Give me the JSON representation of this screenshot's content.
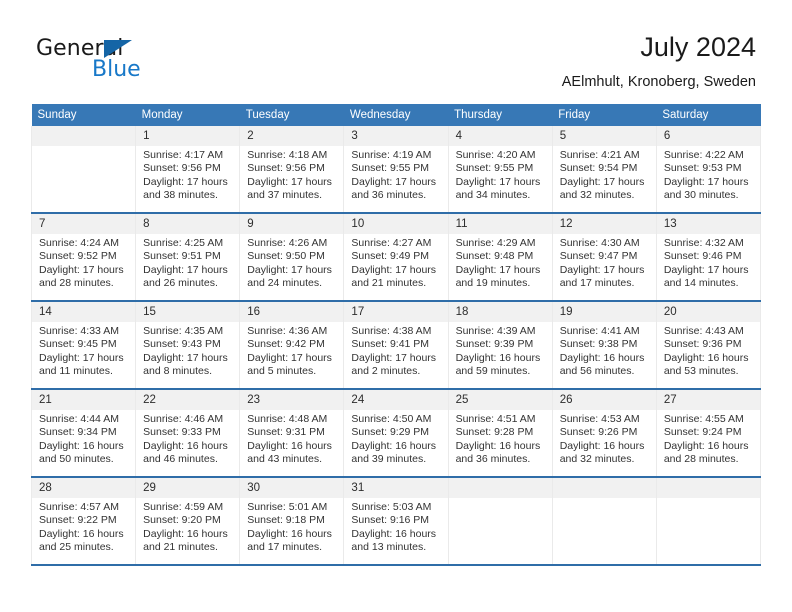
{
  "brand": {
    "name_part1": "General",
    "name_part2": "Blue",
    "logo_icon": "triangle-logo-icon"
  },
  "header": {
    "title": "July 2024",
    "subtitle": "AElmhult, Kronoberg, Sweden"
  },
  "calendar": {
    "weekday_headers": [
      "Sunday",
      "Monday",
      "Tuesday",
      "Wednesday",
      "Thursday",
      "Friday",
      "Saturday"
    ],
    "header_bg_color": "#3778b6",
    "row_separator_color": "#2f6da8",
    "daynum_bg_color": "#f1f1f1",
    "weeks": [
      [
        {
          "day": "",
          "sunrise": "",
          "sunset": "",
          "daylight1": "",
          "daylight2": ""
        },
        {
          "day": "1",
          "sunrise": "Sunrise: 4:17 AM",
          "sunset": "Sunset: 9:56 PM",
          "daylight1": "Daylight: 17 hours",
          "daylight2": "and 38 minutes."
        },
        {
          "day": "2",
          "sunrise": "Sunrise: 4:18 AM",
          "sunset": "Sunset: 9:56 PM",
          "daylight1": "Daylight: 17 hours",
          "daylight2": "and 37 minutes."
        },
        {
          "day": "3",
          "sunrise": "Sunrise: 4:19 AM",
          "sunset": "Sunset: 9:55 PM",
          "daylight1": "Daylight: 17 hours",
          "daylight2": "and 36 minutes."
        },
        {
          "day": "4",
          "sunrise": "Sunrise: 4:20 AM",
          "sunset": "Sunset: 9:55 PM",
          "daylight1": "Daylight: 17 hours",
          "daylight2": "and 34 minutes."
        },
        {
          "day": "5",
          "sunrise": "Sunrise: 4:21 AM",
          "sunset": "Sunset: 9:54 PM",
          "daylight1": "Daylight: 17 hours",
          "daylight2": "and 32 minutes."
        },
        {
          "day": "6",
          "sunrise": "Sunrise: 4:22 AM",
          "sunset": "Sunset: 9:53 PM",
          "daylight1": "Daylight: 17 hours",
          "daylight2": "and 30 minutes."
        }
      ],
      [
        {
          "day": "7",
          "sunrise": "Sunrise: 4:24 AM",
          "sunset": "Sunset: 9:52 PM",
          "daylight1": "Daylight: 17 hours",
          "daylight2": "and 28 minutes."
        },
        {
          "day": "8",
          "sunrise": "Sunrise: 4:25 AM",
          "sunset": "Sunset: 9:51 PM",
          "daylight1": "Daylight: 17 hours",
          "daylight2": "and 26 minutes."
        },
        {
          "day": "9",
          "sunrise": "Sunrise: 4:26 AM",
          "sunset": "Sunset: 9:50 PM",
          "daylight1": "Daylight: 17 hours",
          "daylight2": "and 24 minutes."
        },
        {
          "day": "10",
          "sunrise": "Sunrise: 4:27 AM",
          "sunset": "Sunset: 9:49 PM",
          "daylight1": "Daylight: 17 hours",
          "daylight2": "and 21 minutes."
        },
        {
          "day": "11",
          "sunrise": "Sunrise: 4:29 AM",
          "sunset": "Sunset: 9:48 PM",
          "daylight1": "Daylight: 17 hours",
          "daylight2": "and 19 minutes."
        },
        {
          "day": "12",
          "sunrise": "Sunrise: 4:30 AM",
          "sunset": "Sunset: 9:47 PM",
          "daylight1": "Daylight: 17 hours",
          "daylight2": "and 17 minutes."
        },
        {
          "day": "13",
          "sunrise": "Sunrise: 4:32 AM",
          "sunset": "Sunset: 9:46 PM",
          "daylight1": "Daylight: 17 hours",
          "daylight2": "and 14 minutes."
        }
      ],
      [
        {
          "day": "14",
          "sunrise": "Sunrise: 4:33 AM",
          "sunset": "Sunset: 9:45 PM",
          "daylight1": "Daylight: 17 hours",
          "daylight2": "and 11 minutes."
        },
        {
          "day": "15",
          "sunrise": "Sunrise: 4:35 AM",
          "sunset": "Sunset: 9:43 PM",
          "daylight1": "Daylight: 17 hours",
          "daylight2": "and 8 minutes."
        },
        {
          "day": "16",
          "sunrise": "Sunrise: 4:36 AM",
          "sunset": "Sunset: 9:42 PM",
          "daylight1": "Daylight: 17 hours",
          "daylight2": "and 5 minutes."
        },
        {
          "day": "17",
          "sunrise": "Sunrise: 4:38 AM",
          "sunset": "Sunset: 9:41 PM",
          "daylight1": "Daylight: 17 hours",
          "daylight2": "and 2 minutes."
        },
        {
          "day": "18",
          "sunrise": "Sunrise: 4:39 AM",
          "sunset": "Sunset: 9:39 PM",
          "daylight1": "Daylight: 16 hours",
          "daylight2": "and 59 minutes."
        },
        {
          "day": "19",
          "sunrise": "Sunrise: 4:41 AM",
          "sunset": "Sunset: 9:38 PM",
          "daylight1": "Daylight: 16 hours",
          "daylight2": "and 56 minutes."
        },
        {
          "day": "20",
          "sunrise": "Sunrise: 4:43 AM",
          "sunset": "Sunset: 9:36 PM",
          "daylight1": "Daylight: 16 hours",
          "daylight2": "and 53 minutes."
        }
      ],
      [
        {
          "day": "21",
          "sunrise": "Sunrise: 4:44 AM",
          "sunset": "Sunset: 9:34 PM",
          "daylight1": "Daylight: 16 hours",
          "daylight2": "and 50 minutes."
        },
        {
          "day": "22",
          "sunrise": "Sunrise: 4:46 AM",
          "sunset": "Sunset: 9:33 PM",
          "daylight1": "Daylight: 16 hours",
          "daylight2": "and 46 minutes."
        },
        {
          "day": "23",
          "sunrise": "Sunrise: 4:48 AM",
          "sunset": "Sunset: 9:31 PM",
          "daylight1": "Daylight: 16 hours",
          "daylight2": "and 43 minutes."
        },
        {
          "day": "24",
          "sunrise": "Sunrise: 4:50 AM",
          "sunset": "Sunset: 9:29 PM",
          "daylight1": "Daylight: 16 hours",
          "daylight2": "and 39 minutes."
        },
        {
          "day": "25",
          "sunrise": "Sunrise: 4:51 AM",
          "sunset": "Sunset: 9:28 PM",
          "daylight1": "Daylight: 16 hours",
          "daylight2": "and 36 minutes."
        },
        {
          "day": "26",
          "sunrise": "Sunrise: 4:53 AM",
          "sunset": "Sunset: 9:26 PM",
          "daylight1": "Daylight: 16 hours",
          "daylight2": "and 32 minutes."
        },
        {
          "day": "27",
          "sunrise": "Sunrise: 4:55 AM",
          "sunset": "Sunset: 9:24 PM",
          "daylight1": "Daylight: 16 hours",
          "daylight2": "and 28 minutes."
        }
      ],
      [
        {
          "day": "28",
          "sunrise": "Sunrise: 4:57 AM",
          "sunset": "Sunset: 9:22 PM",
          "daylight1": "Daylight: 16 hours",
          "daylight2": "and 25 minutes."
        },
        {
          "day": "29",
          "sunrise": "Sunrise: 4:59 AM",
          "sunset": "Sunset: 9:20 PM",
          "daylight1": "Daylight: 16 hours",
          "daylight2": "and 21 minutes."
        },
        {
          "day": "30",
          "sunrise": "Sunrise: 5:01 AM",
          "sunset": "Sunset: 9:18 PM",
          "daylight1": "Daylight: 16 hours",
          "daylight2": "and 17 minutes."
        },
        {
          "day": "31",
          "sunrise": "Sunrise: 5:03 AM",
          "sunset": "Sunset: 9:16 PM",
          "daylight1": "Daylight: 16 hours",
          "daylight2": "and 13 minutes."
        },
        {
          "day": "",
          "sunrise": "",
          "sunset": "",
          "daylight1": "",
          "daylight2": ""
        },
        {
          "day": "",
          "sunrise": "",
          "sunset": "",
          "daylight1": "",
          "daylight2": ""
        },
        {
          "day": "",
          "sunrise": "",
          "sunset": "",
          "daylight1": "",
          "daylight2": ""
        }
      ]
    ]
  }
}
